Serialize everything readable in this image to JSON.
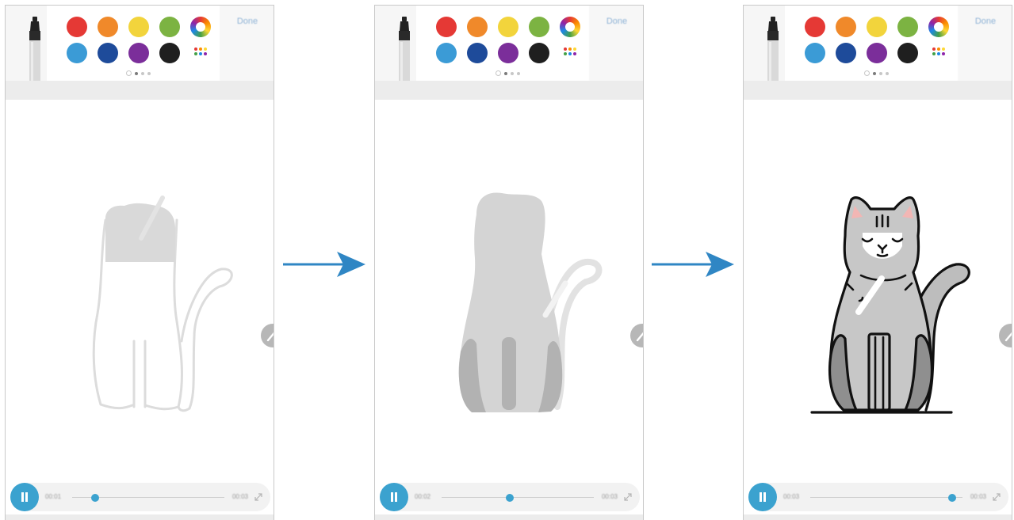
{
  "colors": {
    "accent": "#3ba2cf",
    "arrow": "#2f86c4",
    "swatches": [
      "#e53935",
      "#f0892a",
      "#f2d43c",
      "#7cb342",
      "#3b9bd6",
      "#1e4b9a",
      "#7b2e9a",
      "#1f1f1f"
    ]
  },
  "toolbar": {
    "done_label": "Done"
  },
  "screens": [
    {
      "step": 1,
      "progress": 0.15,
      "time_start": "00:01",
      "time_end": "00:03"
    },
    {
      "step": 2,
      "progress": 0.45,
      "time_start": "00:02",
      "time_end": "00:03"
    },
    {
      "step": 3,
      "progress": 0.93,
      "time_start": "00:03",
      "time_end": "00:03"
    }
  ],
  "icons": [
    "marker-pen-icon",
    "color-wheel-icon",
    "more-colors-icon",
    "pencil-icon",
    "pause-icon",
    "expand-icon",
    "right-arrow-icon"
  ]
}
